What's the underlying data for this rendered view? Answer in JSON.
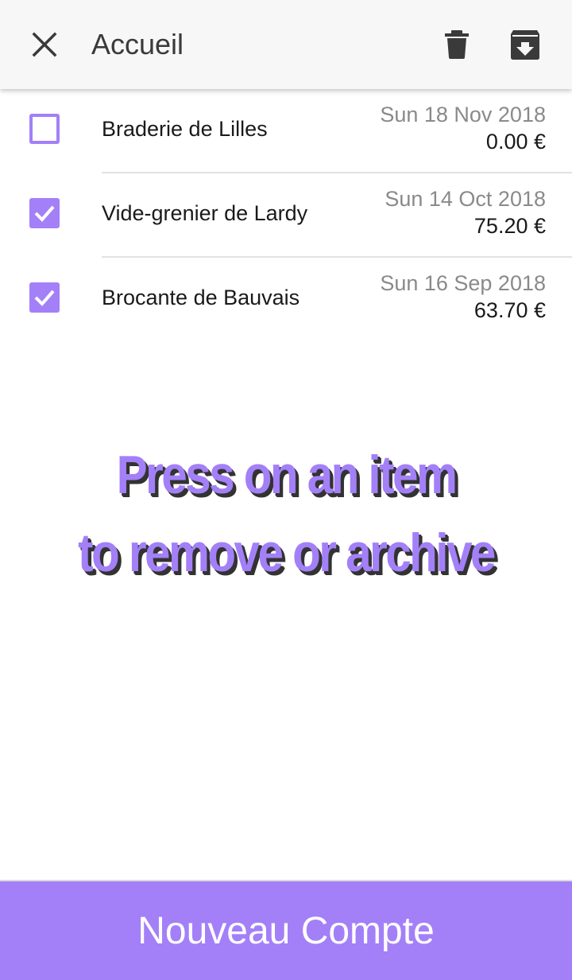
{
  "toolbar": {
    "title": "Accueil",
    "close_icon": "close-icon",
    "delete_icon": "trash-icon",
    "archive_icon": "archive-icon"
  },
  "items": [
    {
      "name": "Braderie de Lilles",
      "date": "Sun 18 Nov 2018",
      "amount": "0.00 €",
      "checked": false
    },
    {
      "name": "Vide-grenier de Lardy",
      "date": "Sun 14 Oct 2018",
      "amount": "75.20 €",
      "checked": true
    },
    {
      "name": "Brocante de Bauvais",
      "date": "Sun 16 Sep 2018",
      "amount": "63.70 €",
      "checked": true
    }
  ],
  "hint": {
    "line1": "Press on an item",
    "line2": "to remove or archive"
  },
  "footer": {
    "button_label": "Nouveau Compte"
  },
  "colors": {
    "accent": "#a380f7",
    "toolbar_bg": "#f7f7f7",
    "icon": "#3a3a3a"
  }
}
